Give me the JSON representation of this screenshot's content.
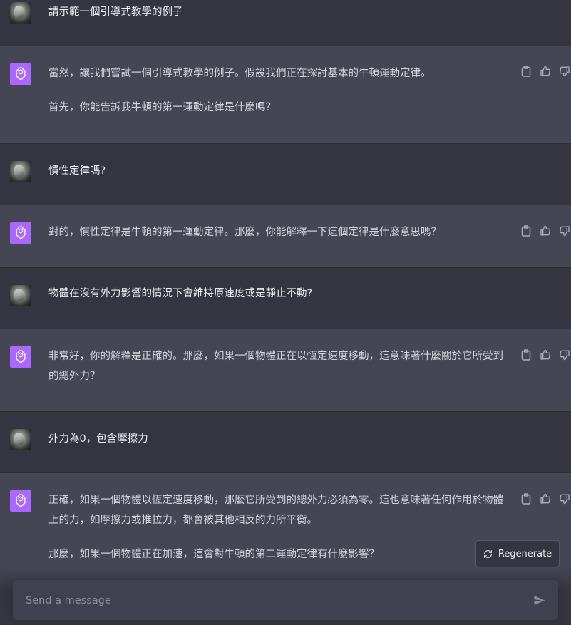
{
  "conversation": [
    {
      "role": "user",
      "paragraphs": [
        "請示範一個引導式教學的例子"
      ]
    },
    {
      "role": "assistant",
      "paragraphs": [
        "當然，讓我們嘗試一個引導式教學的例子。假設我們正在探討基本的牛頓運動定律。",
        "首先，你能告訴我牛頓的第一運動定律是什麼嗎？"
      ]
    },
    {
      "role": "user",
      "paragraphs": [
        "慣性定律嗎?"
      ]
    },
    {
      "role": "assistant",
      "paragraphs": [
        "對的，慣性定律是牛頓的第一運動定律。那麼，你能解釋一下這個定律是什麼意思嗎？"
      ]
    },
    {
      "role": "user",
      "paragraphs": [
        "物體在沒有外力影響的情況下會維持原速度或是靜止不動?"
      ]
    },
    {
      "role": "assistant",
      "paragraphs": [
        "非常好，你的解釋是正確的。那麼，如果一個物體正在以恆定速度移動，這意味著什麼關於它所受到的總外力？"
      ]
    },
    {
      "role": "user",
      "paragraphs": [
        "外力為0，包含摩擦力"
      ]
    },
    {
      "role": "assistant",
      "paragraphs": [
        "正確，如果一個物體以恆定速度移動，那麼它所受到的總外力必須為零。這也意味著任何作用於物體上的力，如摩擦力或推拉力，都會被其他相反的力所平衡。",
        "那麼，如果一個物體正在加速，這會對牛頓的第二運動定律有什麼影響？"
      ]
    }
  ],
  "regenerate_label": "Regenerate",
  "input": {
    "placeholder": "Send a message",
    "value": ""
  },
  "icons": {
    "assistant_avatar": "openai-logo-icon",
    "copy": "clipboard-icon",
    "like": "thumbs-up-icon",
    "dislike": "thumbs-down-icon",
    "regenerate": "refresh-icon",
    "send": "send-icon"
  },
  "colors": {
    "background": "#343541",
    "assistant_background": "#444654",
    "assistant_avatar": "#ab68ff",
    "input_background": "#40414f"
  }
}
